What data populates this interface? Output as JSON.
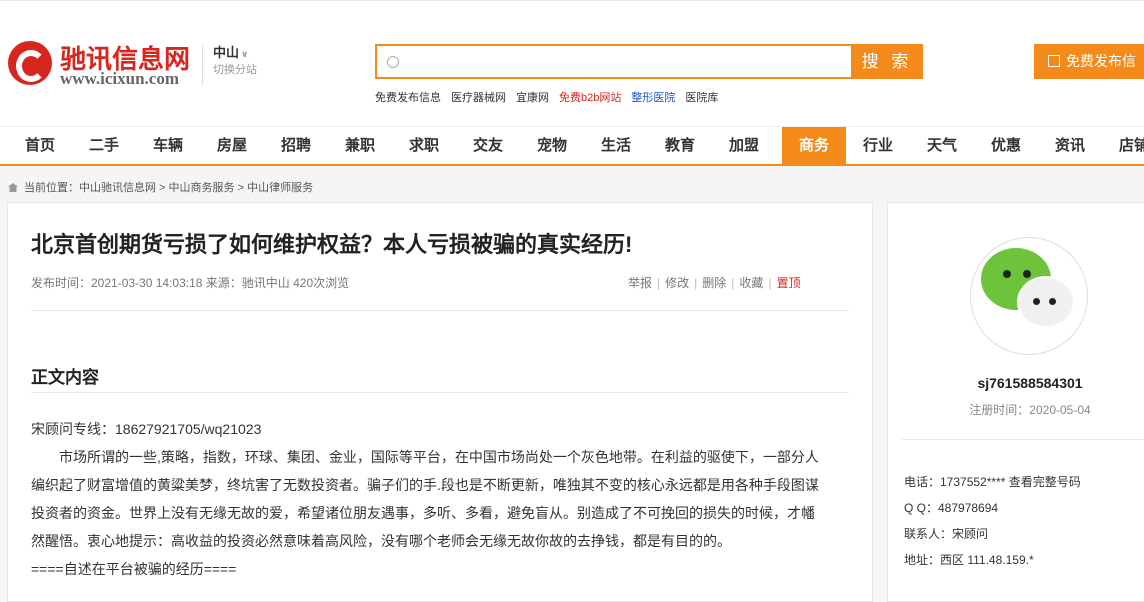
{
  "header": {
    "logo_name": "驰讯信息网",
    "logo_url": "www.icixun.com",
    "city": "中山",
    "city_switch": "切换分站",
    "search_placeholder": "",
    "search_button": "搜 索",
    "post_button": "免费发布信",
    "hotlinks": [
      "免费发布信息",
      "医疗器械网",
      "宜康网",
      "免费b2b网站",
      "整形医院",
      "医院库"
    ],
    "hotlink_colors": [
      "#333333",
      "#333333",
      "#333333",
      "#d7261e",
      "#1a55c9",
      "#333333"
    ]
  },
  "nav": {
    "items": [
      "首页",
      "二手",
      "车辆",
      "房屋",
      "招聘",
      "兼职",
      "求职",
      "交友",
      "宠物",
      "生活",
      "教育",
      "加盟",
      "商务",
      "行业",
      "天气",
      "优惠",
      "资讯",
      "店铺"
    ],
    "active": "商务",
    "accent": "#f38a1a"
  },
  "breadcrumb": "当前位置：中山驰讯信息网 > 中山商务服务 > 中山律师服务",
  "article": {
    "title": "北京首创期货亏损了如何维护权益？本人亏损被骗的真实经历!",
    "meta": "发布时间：2021-03-30 14:03:18   来源：驰讯中山   420次浏览",
    "actions": {
      "report": "举报",
      "edit": "修改",
      "delete": "删除",
      "favorite": "收藏",
      "pin": "置顶"
    },
    "section_heading": "正文内容",
    "hotline": "宋顾问专线：18627921705/wq21023",
    "lines": [
      "市场所谓的一些,策略，指数，环球、集团、金业，国际等平台，在中国市场尚处一个灰色地带。在利益的驱使下，一部分人",
      "编织起了财富增值的黄粱美梦，终坑害了无数投资者。骗子们的手.段也是不断更新，唯独其不变的核心永远都是用各种手段图谋",
      "投资者的资金。世界上没有无缘无故的爱，希望诸位朋友遇事，多听、多看，避免盲从。别造成了不可挽回的损失的时候，才幡",
      "然醒悟。衷心地提示：高收益的投资必然意味着高风险，没有哪个老师会无缘无故你故的去挣钱，都是有目的的。"
    ],
    "footer_line": "====自述在平台被骗的经历===="
  },
  "sidebar": {
    "username": "sj761588584301",
    "register_time": "注册时间：2020-05-04",
    "phone_label": "电话：1737552****",
    "phone_full": "查看完整号码",
    "qq": "Q Q：487978694",
    "contact": "联系人：宋顾问",
    "address": "地址：西区 111.48.159.*"
  }
}
